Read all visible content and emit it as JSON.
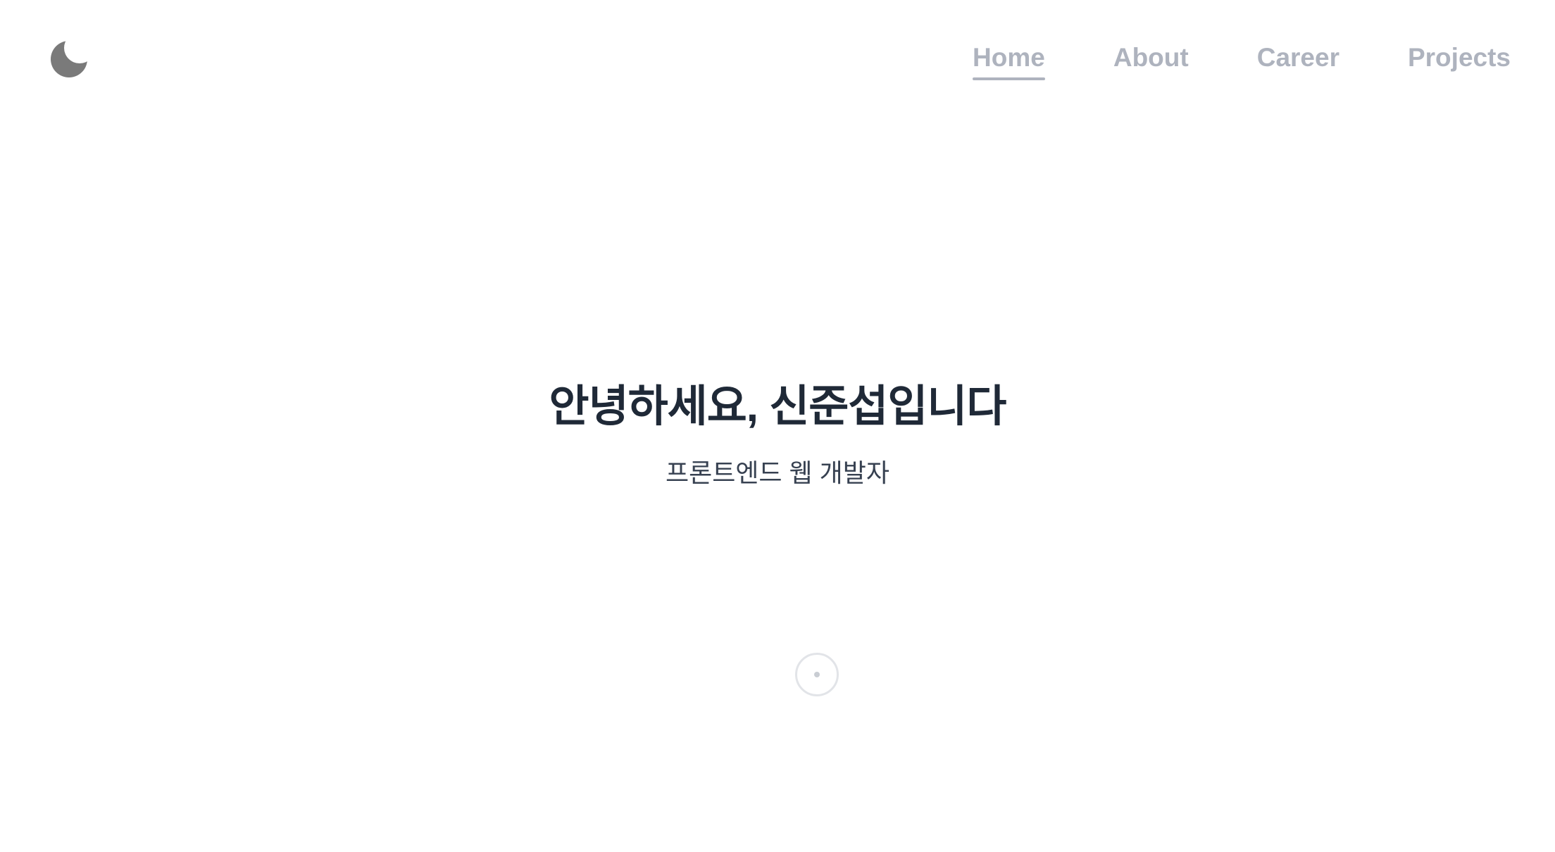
{
  "header": {
    "theme_toggle_icon": "moon-icon",
    "nav": [
      {
        "label": "Home",
        "active": true
      },
      {
        "label": "About",
        "active": false
      },
      {
        "label": "Career",
        "active": false
      },
      {
        "label": "Projects",
        "active": false
      }
    ]
  },
  "hero": {
    "title": "안녕하세요, 신준섭입니다",
    "subtitle": "프론트엔드 웹 개발자"
  },
  "scroll_indicator": {
    "icon": "scroll-down-indicator-icon"
  },
  "colors": {
    "nav_text": "#aeb3be",
    "title_text": "#1f2937",
    "subtitle_text": "#374151",
    "moon_icon": "#7a7a7a"
  }
}
